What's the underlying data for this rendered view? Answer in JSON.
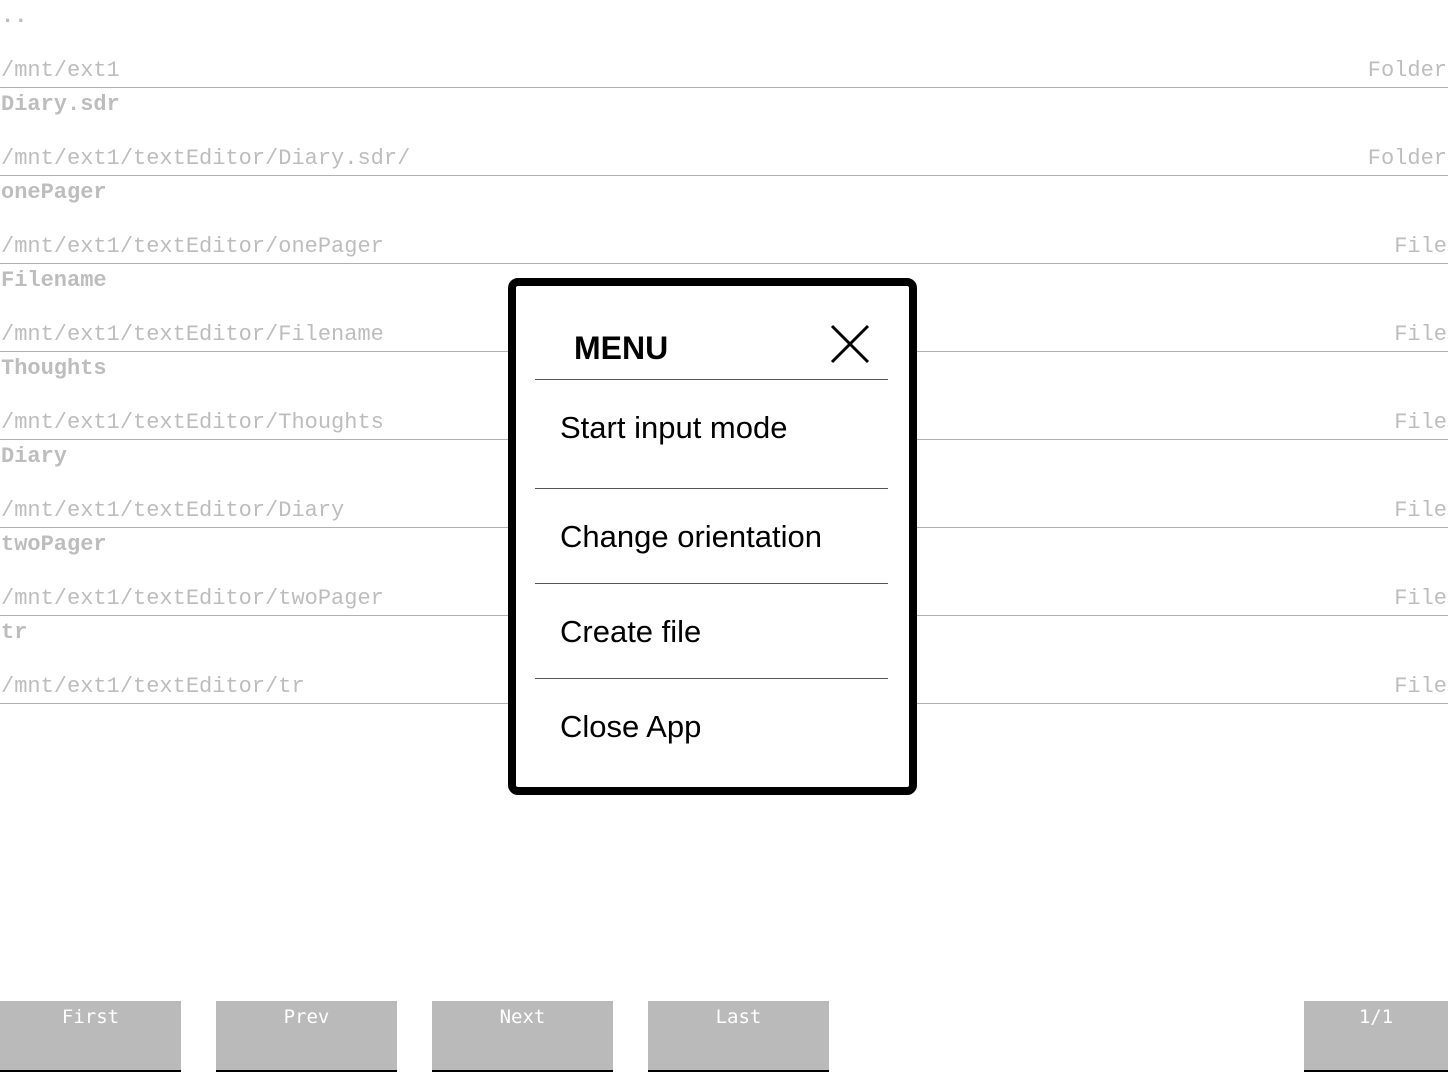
{
  "entries": [
    {
      "name": "..",
      "path": "/mnt/ext1",
      "type": "Folder"
    },
    {
      "name": "Diary.sdr",
      "path": "/mnt/ext1/textEditor/Diary.sdr/",
      "type": "Folder"
    },
    {
      "name": "onePager",
      "path": "/mnt/ext1/textEditor/onePager",
      "type": "File"
    },
    {
      "name": "Filename",
      "path": "/mnt/ext1/textEditor/Filename",
      "type": "File"
    },
    {
      "name": "Thoughts",
      "path": "/mnt/ext1/textEditor/Thoughts",
      "type": "File"
    },
    {
      "name": "Diary",
      "path": "/mnt/ext1/textEditor/Diary",
      "type": "File"
    },
    {
      "name": "twoPager",
      "path": "/mnt/ext1/textEditor/twoPager",
      "type": "File"
    },
    {
      "name": "tr",
      "path": "/mnt/ext1/textEditor/tr",
      "type": "File"
    }
  ],
  "nav": {
    "first": "First",
    "prev": "Prev",
    "next": "Next",
    "last": "Last",
    "page": "1/1"
  },
  "menu": {
    "title": "MENU",
    "items": [
      "Start input mode",
      "Change orientation",
      "Create file",
      "Close App"
    ]
  }
}
